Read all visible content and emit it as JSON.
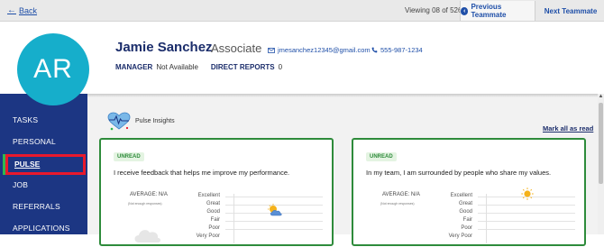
{
  "topbar": {
    "back_label": "Back",
    "viewing_text": "Viewing 08 of 526",
    "prev_label": "Previous Teammate",
    "next_label": "Next Teammate"
  },
  "employee": {
    "initials": "AR",
    "name": "Jamie Sanchez",
    "title": "Associate",
    "email": "jmesanchez12345@gmail.com",
    "phone": "555-987-1234",
    "manager_label": "MANAGER",
    "manager_value": "Not Available",
    "reports_label": "DIRECT REPORTS",
    "reports_value": "0"
  },
  "sidebar": {
    "items": [
      {
        "label": "TASKS"
      },
      {
        "label": "PERSONAL"
      },
      {
        "label": "PULSE",
        "active": true
      },
      {
        "label": "JOB"
      },
      {
        "label": "REFERRALS"
      },
      {
        "label": "APPLICATIONS"
      }
    ]
  },
  "pulse": {
    "section_title": "Pulse Insights",
    "mark_all_label": "Mark all as read",
    "cards": [
      {
        "badge": "UNREAD",
        "question": "I receive feedback that helps me improve my performance.",
        "average": "AVERAGE: N/A",
        "average_note": "(Not enough responses)",
        "scale": [
          "Excellent",
          "Great",
          "Good",
          "Fair",
          "Poor",
          "Very Poor"
        ],
        "weather_icon": "partly-cloudy-icon",
        "highlight_level": "Great"
      },
      {
        "badge": "UNREAD",
        "question": "In my team, I am surrounded by people who share my values.",
        "average": "AVERAGE: N/A",
        "average_note": "(Not enough responses)",
        "scale": [
          "Excellent",
          "Great",
          "Good",
          "Fair",
          "Poor",
          "Very Poor"
        ],
        "weather_icon": "sun-icon",
        "highlight_level": "Excellent"
      }
    ]
  },
  "colors": {
    "sidebar_bg": "#1c3683",
    "accent_blue": "#1f4fa8",
    "avatar_bg": "#16aecb",
    "card_border": "#2e8b3b",
    "active_outline": "#e8192c",
    "active_marker": "#2fb84f"
  }
}
